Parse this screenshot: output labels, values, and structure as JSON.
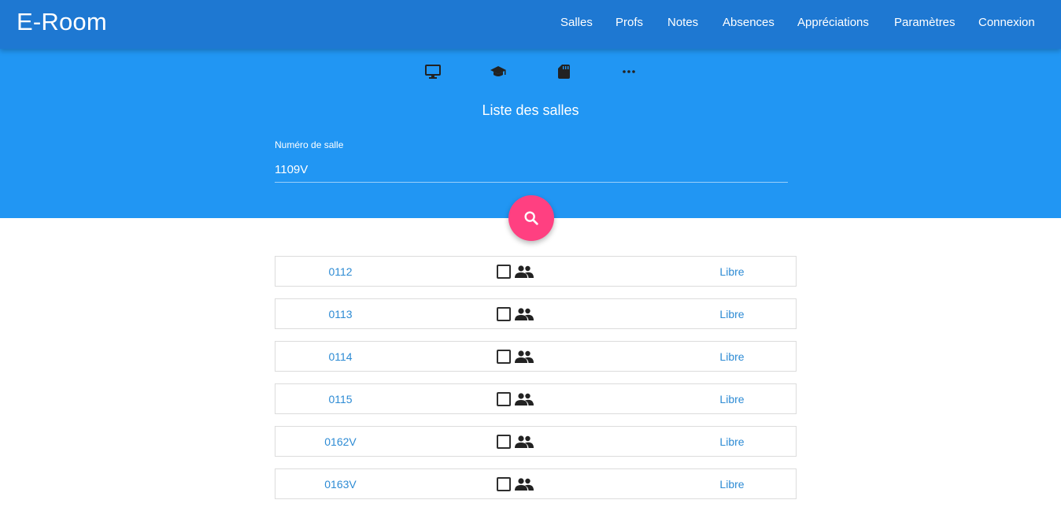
{
  "app": {
    "brand": "E-Room"
  },
  "nav": {
    "items": [
      {
        "label": "Salles"
      },
      {
        "label": "Profs"
      },
      {
        "label": "Notes"
      },
      {
        "label": "Absences"
      },
      {
        "label": "Appréciations"
      },
      {
        "label": "Paramètres"
      },
      {
        "label": "Connexion"
      }
    ]
  },
  "toolbar": {
    "icons": [
      "monitor-icon",
      "graduation-cap-icon",
      "sd-card-icon",
      "more-horizontal-icon"
    ]
  },
  "search": {
    "title": "Liste des salles",
    "label": "Numéro de salle",
    "value": "1109V",
    "button_icon": "search-icon"
  },
  "rooms": [
    {
      "number": "0112",
      "status": "Libre"
    },
    {
      "number": "0113",
      "status": "Libre"
    },
    {
      "number": "0114",
      "status": "Libre"
    },
    {
      "number": "0115",
      "status": "Libre"
    },
    {
      "number": "0162V",
      "status": "Libre"
    },
    {
      "number": "0163V",
      "status": "Libre"
    }
  ],
  "colors": {
    "navbar": "#1e78d2",
    "hero": "#2196f3",
    "fab": "#ff4081",
    "link": "#2d8bd4"
  }
}
